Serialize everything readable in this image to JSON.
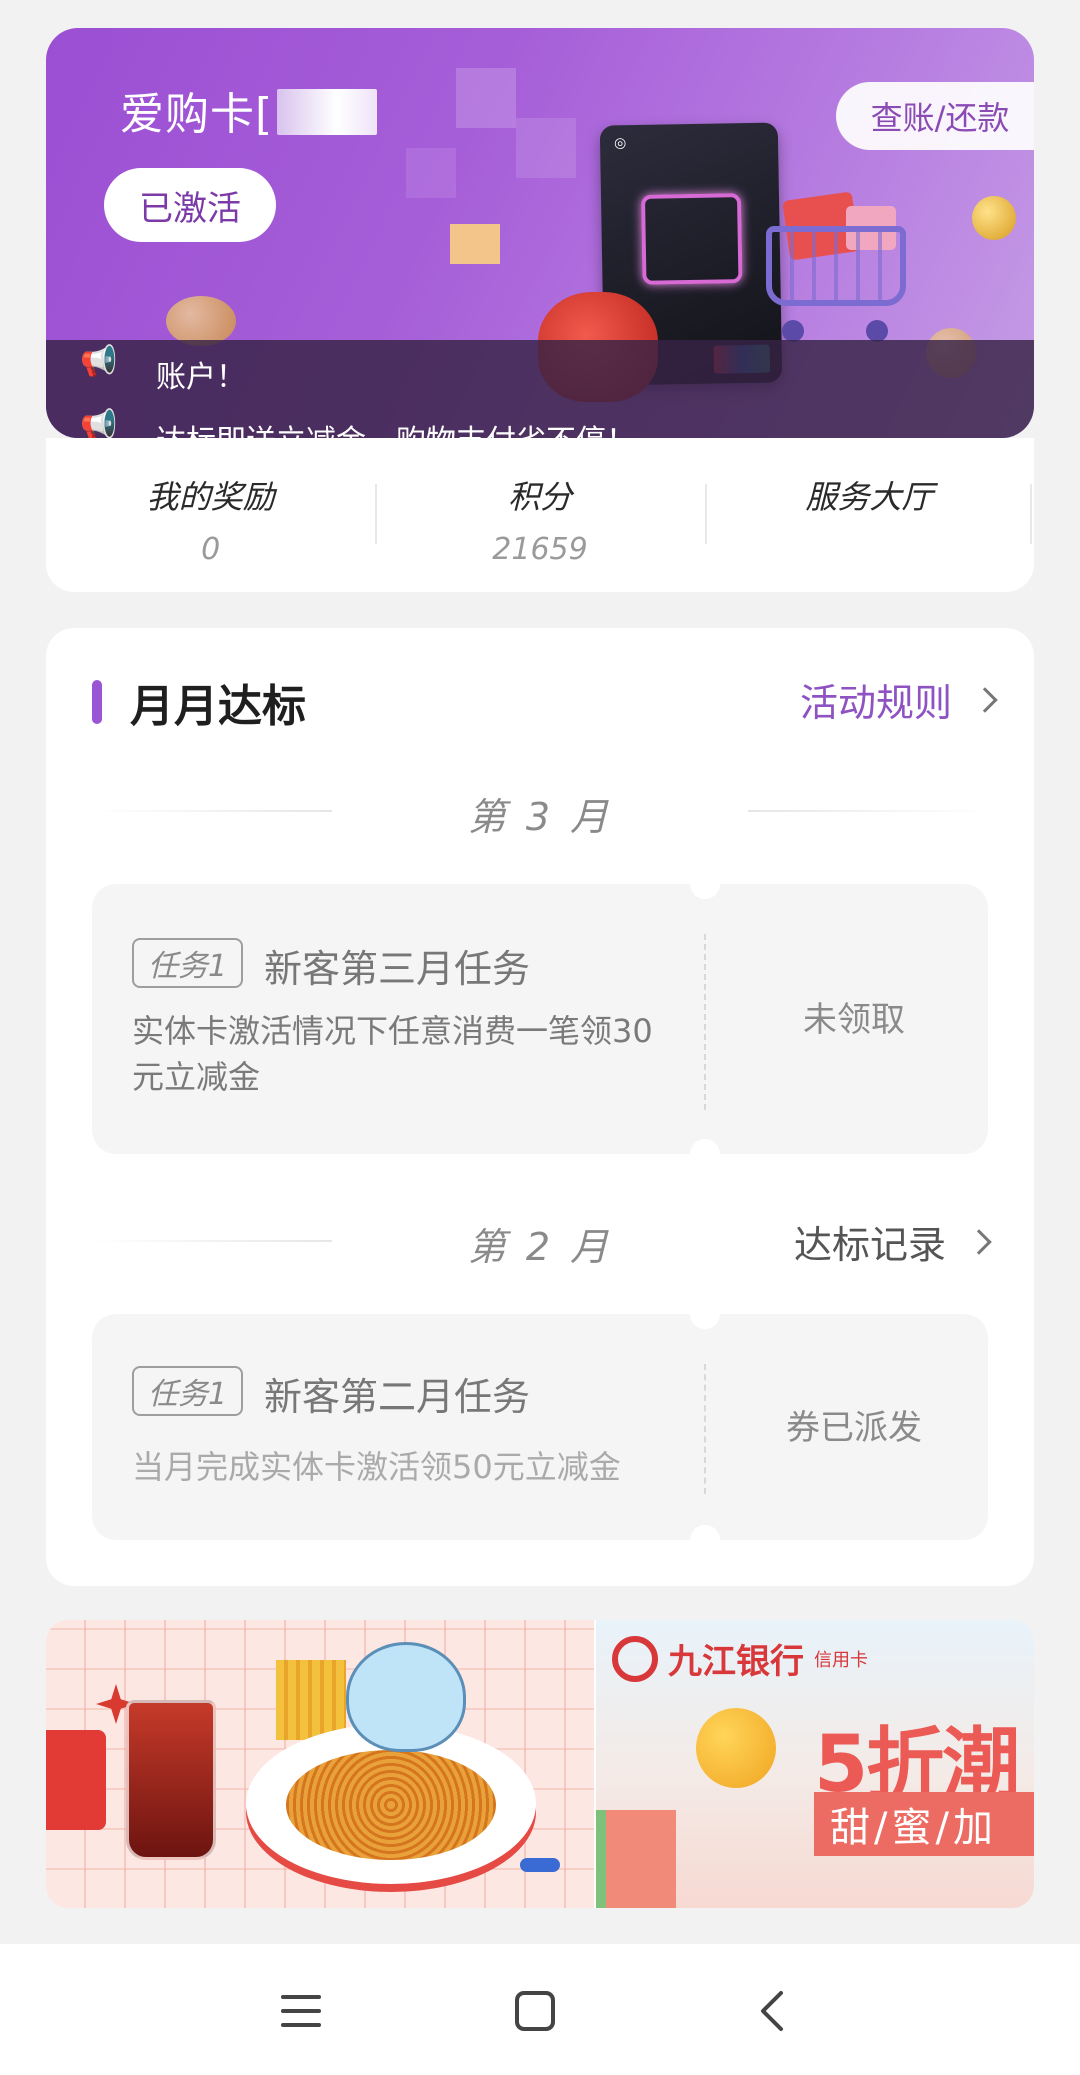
{
  "hero": {
    "card_title": "爱购卡[",
    "status_pill": "已激活",
    "bill_button": "查账/还款",
    "ticker_line1": "账户！",
    "ticker_line2": "达标即送立减金，购物支付省不停！"
  },
  "stats": [
    {
      "label": "我的奖励",
      "value": "0"
    },
    {
      "label": "积分",
      "value": "21659"
    },
    {
      "label": "服务大厅",
      "value": ""
    }
  ],
  "monthly": {
    "title": "月月达标",
    "rules_link": "活动规则",
    "records_link": "达标记录",
    "months": [
      {
        "label": "第 3 月",
        "task": {
          "tag": "任务1",
          "name": "新客第三月任务",
          "desc": "实体卡激活情况下任意消费一笔领30元立减金",
          "status": "未领取"
        }
      },
      {
        "label": "第 2 月",
        "task": {
          "tag": "任务1",
          "name": "新客第二月任务",
          "desc": "当月完成实体卡激活领50元立减金",
          "status": "券已派发"
        }
      }
    ]
  },
  "banners": {
    "right_bank_name": "九江银行",
    "right_bank_sub": "信用卡",
    "right_headline": "5折潮",
    "right_ribbon": "甜/蜜/加"
  },
  "colors": {
    "accent_purple": "#9a55d4",
    "link_purple": "#8e52c3",
    "hero_bg": "#a65ed8"
  },
  "nav": {
    "icons": [
      "menu-icon",
      "home-icon",
      "back-icon"
    ]
  }
}
